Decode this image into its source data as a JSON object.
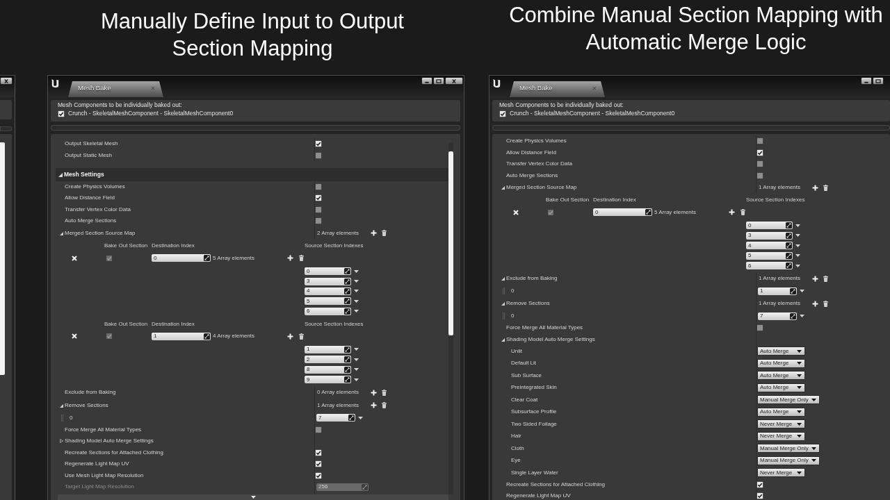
{
  "slides": [
    {
      "heading": "Manually Define Input to Output Section Mapping",
      "window": {
        "tab": {
          "label": "Mesh Bake",
          "selected": true
        },
        "buttons": [
          {
            "kind": "minimize"
          },
          {
            "kind": "maximize"
          },
          {
            "kind": "close"
          }
        ],
        "components_label": "Mesh Components to be individually baked out:",
        "components": [
          {
            "label": "Crunch - SkeletalMeshComponent - SkeletalMeshComponent0",
            "checked": true
          }
        ],
        "scrollbar": true,
        "expander": true,
        "rows": [
          {
            "kind": "checkbox",
            "label": "Output Skeletal Mesh",
            "checked": true
          },
          {
            "kind": "checkbox",
            "label": "Output Static Mesh",
            "checked": false
          },
          {
            "kind": "category",
            "label": "Mesh Settings",
            "expanded": true
          },
          {
            "kind": "checkbox",
            "label": "Create Physics Volumes",
            "checked": false
          },
          {
            "kind": "checkbox",
            "label": "Allow Distance Field",
            "checked": true
          },
          {
            "kind": "checkbox",
            "label": "Transfer Vertex Color Data",
            "checked": false
          },
          {
            "kind": "checkbox",
            "label": "Auto Merge Sections",
            "checked": false
          },
          {
            "kind": "map",
            "label": "Merged Section Source Map",
            "expanded": true,
            "count": "2 Array elements",
            "entries": [
              {
                "headers": [
                  "Bake Out Section",
                  "Destination Index",
                  "Source Section Indexes"
                ],
                "bake_out": {
                  "checked": true,
                  "disabled": true
                },
                "destination": "0",
                "count": "5 Array elements",
                "sources": [
                  "0",
                  "3",
                  "4",
                  "5",
                  "6"
                ]
              },
              {
                "headers": [
                  "Bake Out Section",
                  "Destination Index",
                  "Source Section Indexes"
                ],
                "bake_out": {
                  "checked": true,
                  "disabled": true
                },
                "destination": "1",
                "count": "4 Array elements",
                "sources": [
                  "1",
                  "2",
                  "8",
                  "9"
                ]
              }
            ]
          },
          {
            "kind": "array",
            "label": "Exclude from Baking",
            "count": "0 Array elements"
          },
          {
            "kind": "array",
            "label": "Remove Sections",
            "expanded": true,
            "count": "1 Array elements",
            "items": [
              {
                "index": "0",
                "value": "7"
              }
            ]
          },
          {
            "kind": "checkbox",
            "label": "Force Merge All Material Types",
            "checked": false
          },
          {
            "kind": "group",
            "label": "Shading Model Auto Merge Settings",
            "expanded": false
          },
          {
            "kind": "checkbox",
            "label": "Recreate Sections for Attached Clothing",
            "checked": true
          },
          {
            "kind": "checkbox",
            "label": "Regenerate Light Map UV",
            "checked": true
          },
          {
            "kind": "checkbox",
            "label": "Use Mesh Light Map Resolution",
            "checked": true
          },
          {
            "kind": "number",
            "label": "Target Light Map Resolution",
            "value": "256",
            "disabled": true
          }
        ]
      }
    },
    {
      "heading": "Combine Manual Section Mapping with Automatic Merge Logic",
      "window": {
        "tab": {
          "label": "Mesh Bake",
          "selected": true
        },
        "buttons": [
          {
            "kind": "minimize"
          },
          {
            "kind": "maximize"
          }
        ],
        "components_label": "Mesh Components to be individually baked out:",
        "components": [
          {
            "label": "Crunch - SkeletalMeshComponent - SkeletalMeshComponent0",
            "checked": true
          }
        ],
        "rows": [
          {
            "kind": "checkbox",
            "label": "Create Physics Volumes",
            "checked": false
          },
          {
            "kind": "checkbox",
            "label": "Allow Distance Field",
            "checked": true
          },
          {
            "kind": "checkbox",
            "label": "Transfer Vertex Color Data",
            "checked": false
          },
          {
            "kind": "checkbox",
            "label": "Auto Merge Sections",
            "checked": false
          },
          {
            "kind": "map",
            "label": "Merged Section Source Map",
            "expanded": true,
            "count": "1 Array elements",
            "entries": [
              {
                "headers": [
                  "Bake Out Section",
                  "Destination Index",
                  "Source Section Indexes"
                ],
                "bake_out": {
                  "checked": true,
                  "disabled": true
                },
                "destination": "0",
                "count": "5 Array elements",
                "sources": [
                  "0",
                  "3",
                  "4",
                  "5",
                  "6"
                ]
              }
            ]
          },
          {
            "kind": "array",
            "label": "Exclude from Baking",
            "expanded": true,
            "count": "1 Array elements",
            "items": [
              {
                "index": "0",
                "value": "1"
              }
            ]
          },
          {
            "kind": "array",
            "label": "Remove Sections",
            "expanded": true,
            "count": "1 Array elements",
            "items": [
              {
                "index": "0",
                "value": "7"
              }
            ]
          },
          {
            "kind": "checkbox",
            "label": "Force Merge All Material Types",
            "checked": false
          },
          {
            "kind": "group",
            "label": "Shading Model Auto Merge Settings",
            "expanded": true,
            "children": [
              {
                "kind": "dropdown",
                "label": "Unlit",
                "value": "Auto Merge"
              },
              {
                "kind": "dropdown",
                "label": "Default Lit",
                "value": "Auto Merge"
              },
              {
                "kind": "dropdown",
                "label": "Sub Surface",
                "value": "Auto Merge"
              },
              {
                "kind": "dropdown",
                "label": "Preintegrated Skin",
                "value": "Auto Merge"
              },
              {
                "kind": "dropdown",
                "label": "Clear Coat",
                "value": "Manual Merge Only"
              },
              {
                "kind": "dropdown",
                "label": "Subsurface Profile",
                "value": "Auto Merge"
              },
              {
                "kind": "dropdown",
                "label": "Two Sided Foilage",
                "value": "Never Merge"
              },
              {
                "kind": "dropdown",
                "label": "Hair",
                "value": "Never Merge"
              },
              {
                "kind": "dropdown",
                "label": "Cloth",
                "value": "Manual Merge Only"
              },
              {
                "kind": "dropdown",
                "label": "Eye",
                "value": "Manual Merge Only"
              },
              {
                "kind": "dropdown",
                "label": "Single Layer Water",
                "value": "Never Merge"
              }
            ]
          },
          {
            "kind": "checkbox",
            "label": "Recreate Sections for Attached Clothing",
            "checked": true
          },
          {
            "kind": "checkbox",
            "label": "Regenerate Light Map UV",
            "checked": true
          }
        ]
      }
    }
  ]
}
